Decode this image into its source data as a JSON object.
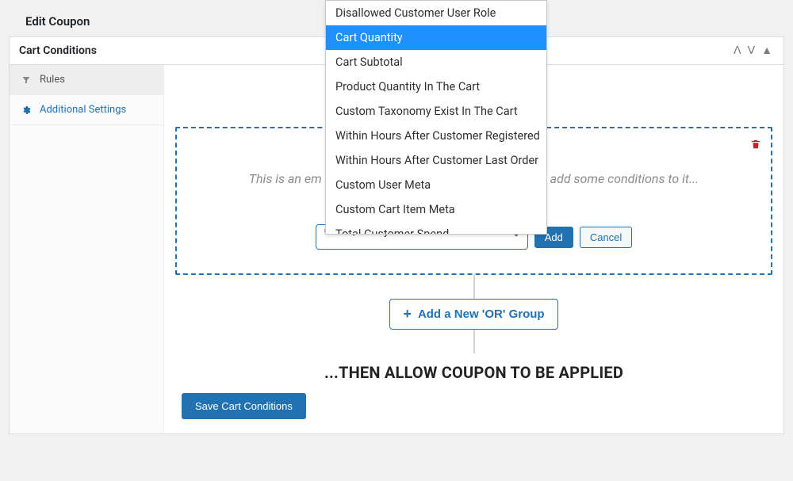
{
  "page_title": "Edit Coupon",
  "panel": {
    "title": "Cart Conditions",
    "ctrl_up": "ᐱ",
    "ctrl_down": "ᐯ",
    "ctrl_collapse": "▲"
  },
  "sidebar": {
    "items": [
      {
        "label": "Rules",
        "icon": "filter-icon",
        "active": true
      },
      {
        "label": "Additional Settings",
        "icon": "gear-icon",
        "active": false
      }
    ]
  },
  "dropdown": {
    "options": [
      "Disallowed Customer User Role",
      "Cart Quantity",
      "Cart Subtotal",
      "Product Quantity In The Cart",
      "Custom Taxonomy Exist In The Cart",
      "Within Hours After Customer Registered",
      "Within Hours After Customer Last Order",
      "Custom User Meta",
      "Custom Cart Item Meta",
      "Total Customer Spend"
    ],
    "selected_index": 1
  },
  "condition": {
    "empty_prefix": "This is an em",
    "empty_suffix": "add some conditions to it...",
    "selected_value": "Cart Quantity",
    "add_label": "Add",
    "cancel_label": "Cancel"
  },
  "add_group_label": "Add a New 'OR' Group",
  "then_text": "...THEN ALLOW COUPON TO BE APPLIED",
  "save_label": "Save Cart Conditions"
}
